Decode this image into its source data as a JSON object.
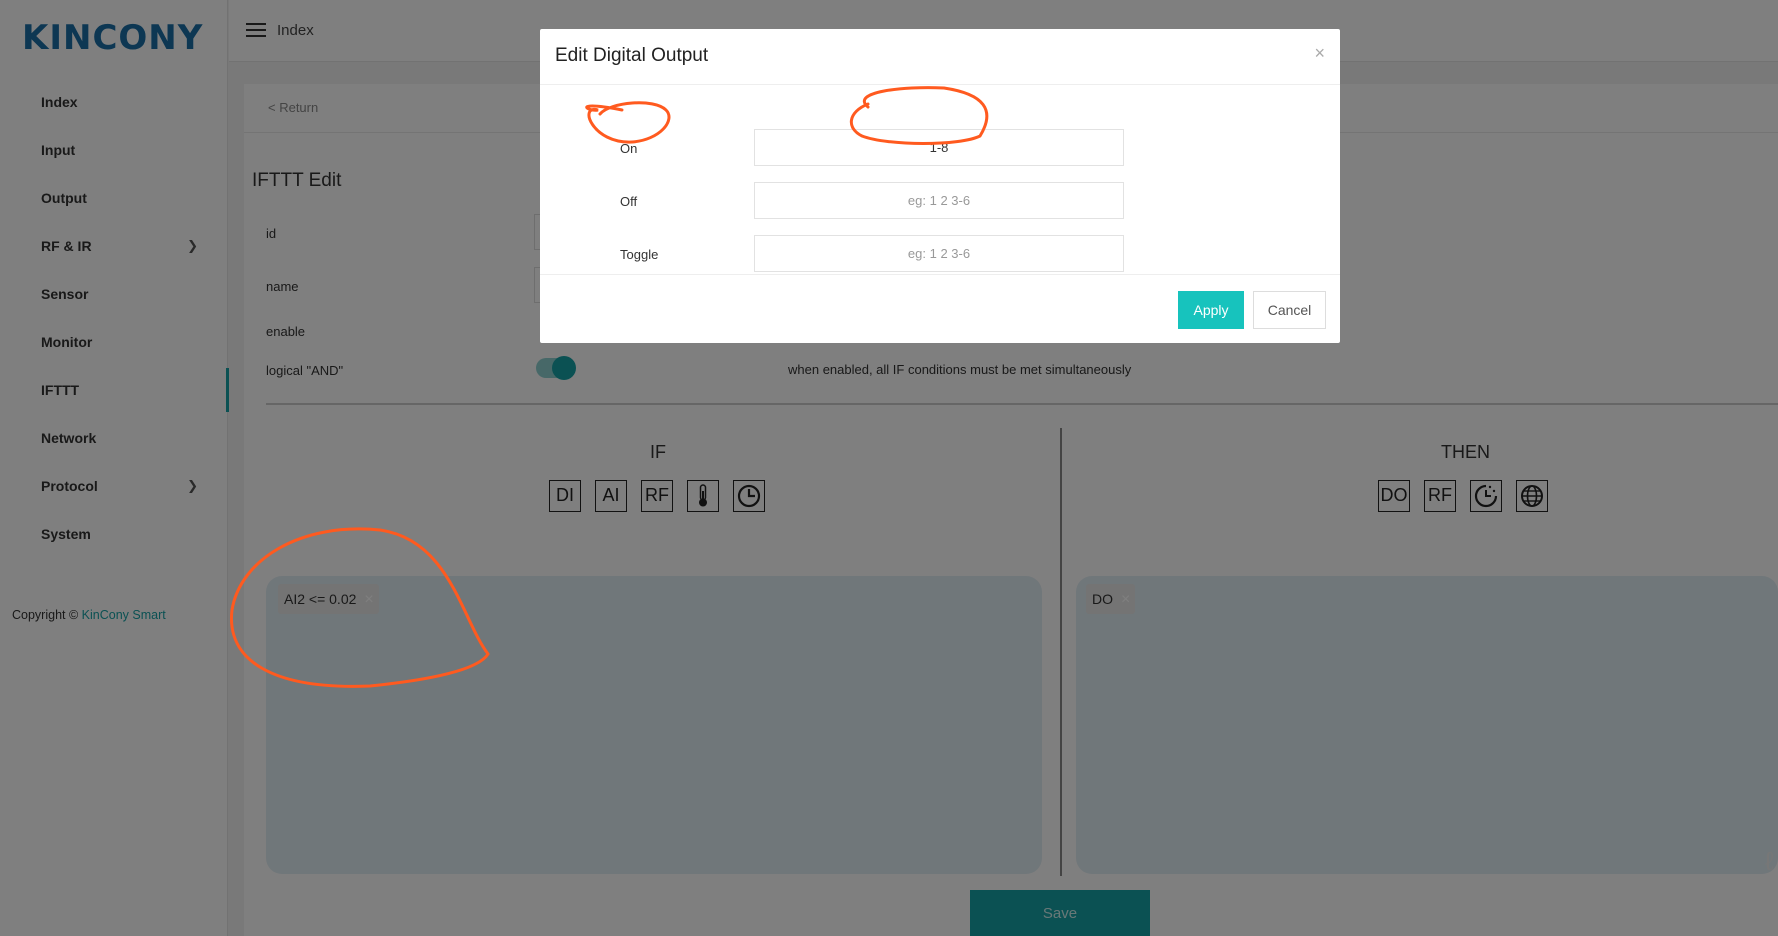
{
  "brand": {
    "logo_text": "KINCONY"
  },
  "sidebar": {
    "items": [
      {
        "label": "Index",
        "chevron": false,
        "active": false
      },
      {
        "label": "Input",
        "chevron": false,
        "active": false
      },
      {
        "label": "Output",
        "chevron": false,
        "active": false
      },
      {
        "label": "RF & IR",
        "chevron": true,
        "active": false
      },
      {
        "label": "Sensor",
        "chevron": false,
        "active": false
      },
      {
        "label": "Monitor",
        "chevron": false,
        "active": false
      },
      {
        "label": "IFTTT",
        "chevron": false,
        "active": true
      },
      {
        "label": "Network",
        "chevron": false,
        "active": false
      },
      {
        "label": "Protocol",
        "chevron": true,
        "active": false
      },
      {
        "label": "System",
        "chevron": false,
        "active": false
      }
    ],
    "copyright_prefix": "Copyright ©",
    "copyright_link": "KinCony Smart"
  },
  "topbar": {
    "title": "Index"
  },
  "page": {
    "return_label": "< Return",
    "title": "IFTTT Edit",
    "fields": {
      "id_label": "id",
      "name_label": "name",
      "enable_label": "enable",
      "logical_and_label": "logical \"AND\""
    },
    "logical_and_note": "when enabled, all IF conditions must be met simultaneously",
    "logical_and_on": true,
    "if_title": "IF",
    "then_title": "THEN",
    "if_icons": [
      "DI",
      "AI",
      "RF",
      "thermometer-icon",
      "clock-icon"
    ],
    "then_icons": [
      "DO",
      "RF",
      "timer-icon",
      "globe-icon"
    ],
    "if_condition": {
      "label": "AI2 <= 0.02",
      "remove": "×"
    },
    "then_action": {
      "label": "DO",
      "remove": "×"
    },
    "save_label": "Save"
  },
  "modal": {
    "title": "Edit Digital Output",
    "close": "×",
    "rows": [
      {
        "label": "On",
        "value": "1-8",
        "placeholder": "eg: 1 2 3-6"
      },
      {
        "label": "Off",
        "value": "",
        "placeholder": "eg: 1 2 3-6"
      },
      {
        "label": "Toggle",
        "value": "",
        "placeholder": "eg: 1 2 3-6"
      }
    ],
    "apply_label": "Apply",
    "cancel_label": "Cancel"
  },
  "colors": {
    "accent": "#17a2a6",
    "apply_button": "#17c3bd",
    "annotation": "#ff5a1f",
    "logo": "#1a6fa6"
  }
}
